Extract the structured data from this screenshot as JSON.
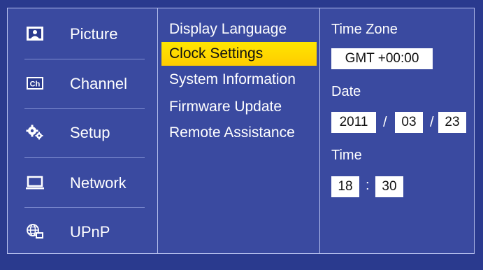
{
  "categories": [
    {
      "label": "Picture",
      "icon": "picture-icon"
    },
    {
      "label": "Channel",
      "icon": "channel-icon"
    },
    {
      "label": "Setup",
      "icon": "gears-icon"
    },
    {
      "label": "Network",
      "icon": "laptop-icon"
    },
    {
      "label": "UPnP",
      "icon": "globe-icon"
    }
  ],
  "menu": {
    "items": [
      "Display Language",
      "Clock Settings",
      "System Information",
      "Firmware Update",
      "Remote Assistance"
    ],
    "selected_index": 1
  },
  "settings": {
    "time_zone_label": "Time Zone",
    "time_zone_value": "GMT +00:00",
    "date_label": "Date",
    "date_year": "2011",
    "date_month": "03",
    "date_day": "23",
    "date_separator": "/",
    "time_label": "Time",
    "time_hour": "18",
    "time_minute": "30",
    "time_separator": ":"
  },
  "colors": {
    "background": "#3a4aa0",
    "frame": "#2a3a8e",
    "highlight": "#ffd400",
    "border": "#b8c2ef"
  }
}
